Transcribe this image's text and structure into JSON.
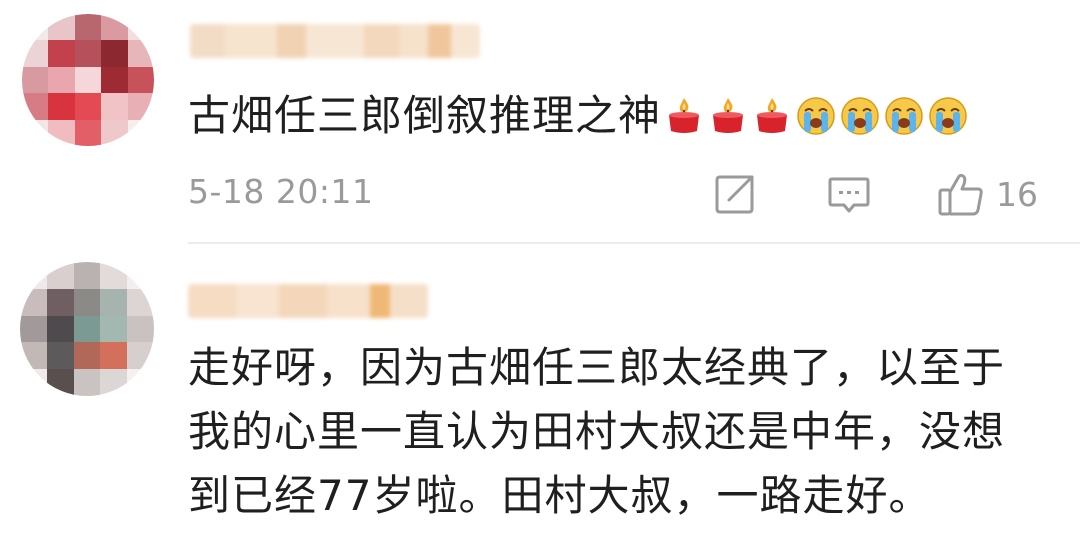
{
  "comments": [
    {
      "text": "古畑任三郎倒叙推理之神",
      "emoji": [
        "candle-emoji",
        "candle-emoji",
        "candle-emoji",
        "crying-face-emoji",
        "crying-face-emoji",
        "crying-face-emoji",
        "crying-face-emoji"
      ],
      "timestamp": "5-18 20:11",
      "likes": "16"
    },
    {
      "lines": [
        "走好呀，因为古畑任三郎太经典了，以至于",
        "我的心里一直认为田村大叔还是中年，没想",
        "到已经77岁啦。田村大叔，一路走好。"
      ]
    }
  ],
  "icons": {
    "share": "share-icon",
    "comment": "comment-icon",
    "like": "thumbs-up-icon"
  },
  "colors": {
    "meta_gray": "#9a9a9a",
    "divider": "#ececec",
    "username_blur": "#f6d9b8"
  }
}
